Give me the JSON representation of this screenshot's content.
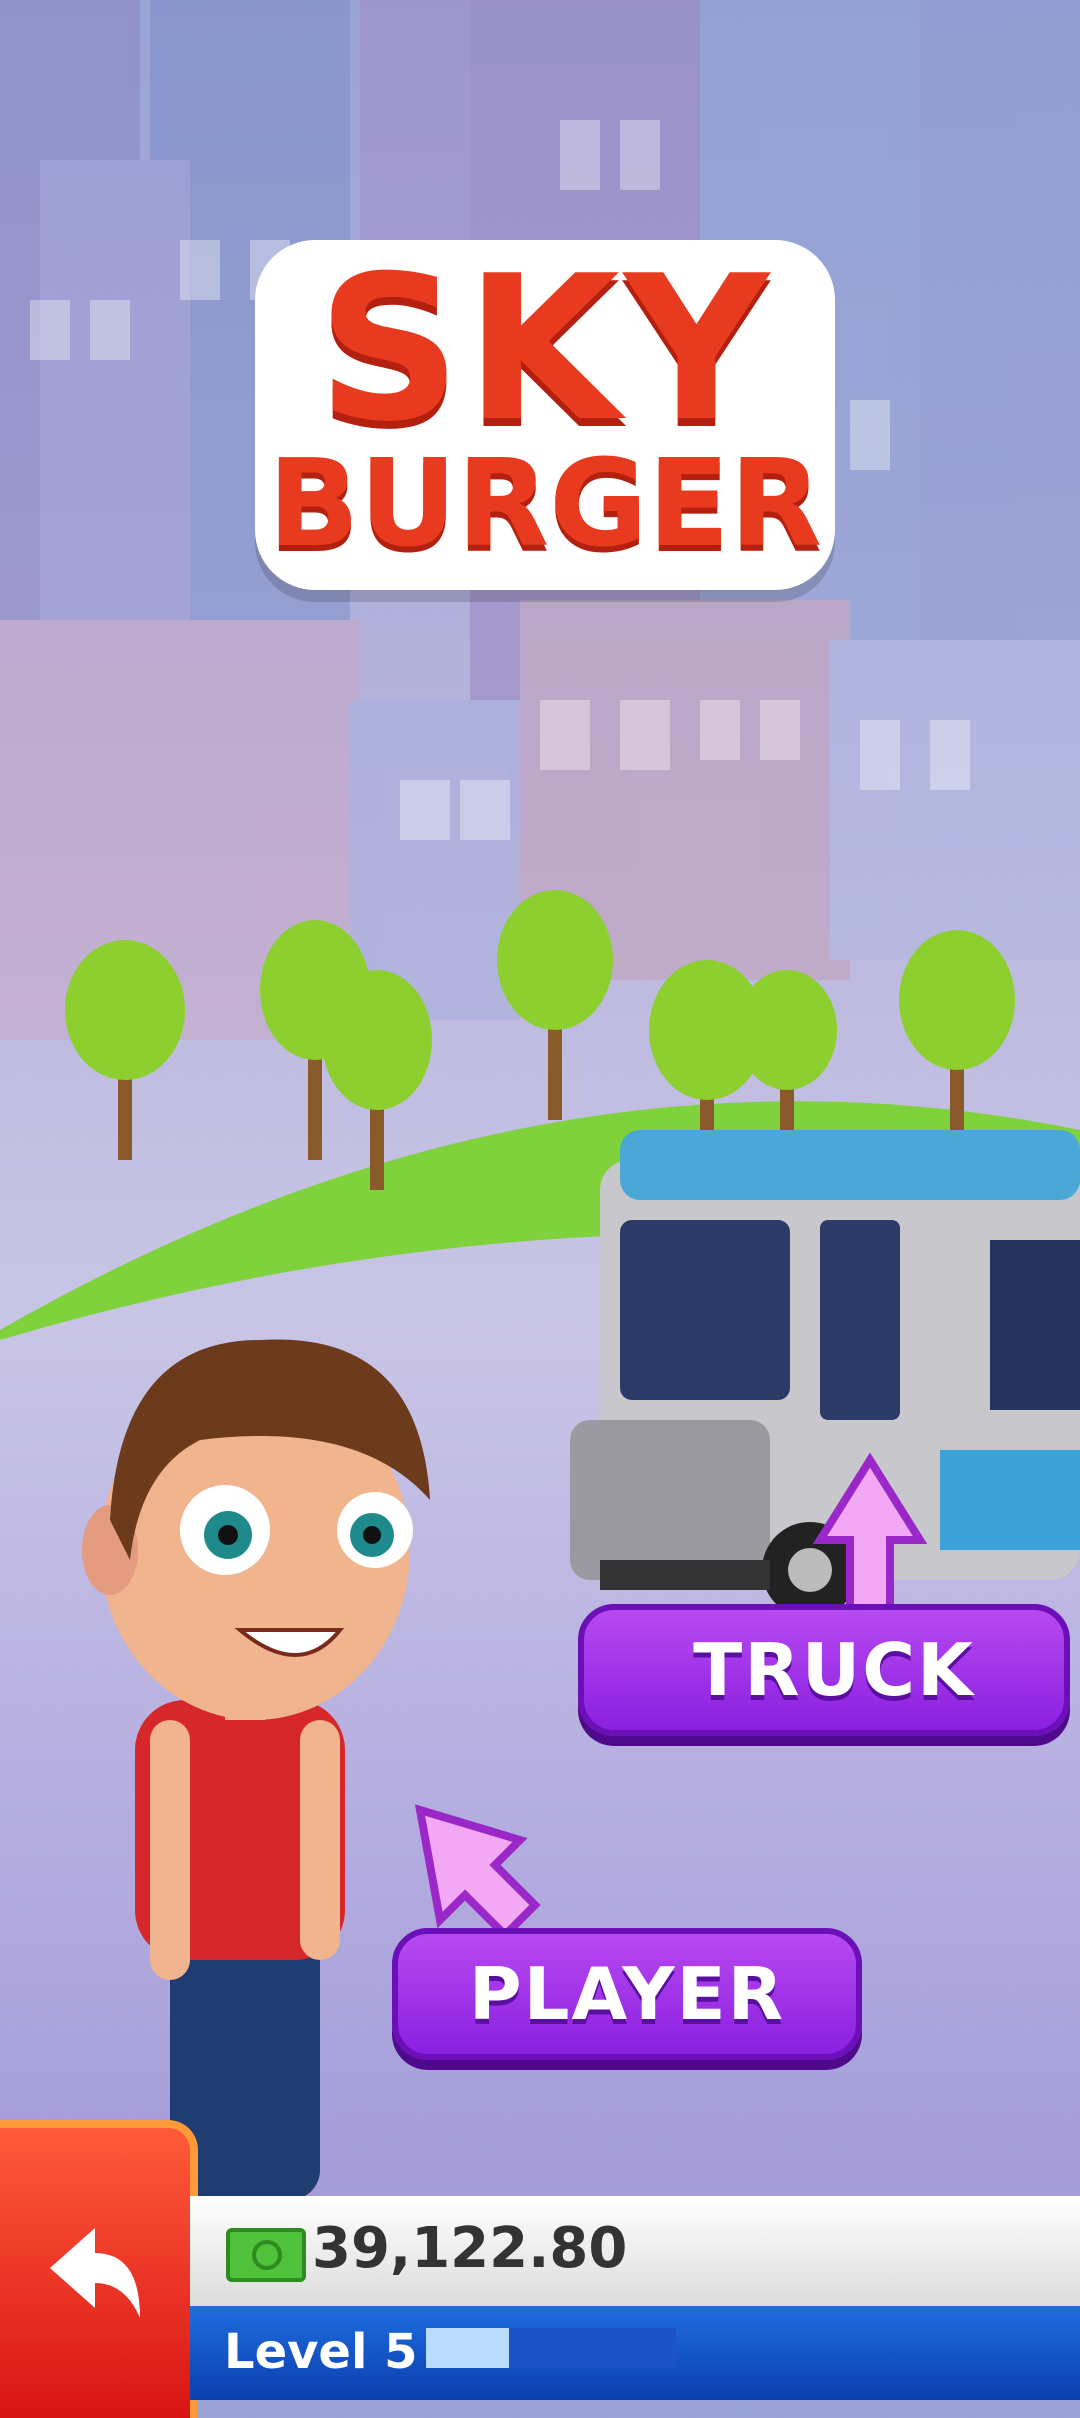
{
  "logo": {
    "line1": "SKY",
    "line2": "BURGER"
  },
  "buttons": {
    "truck": "TRUCK",
    "player": "PLAYER"
  },
  "money": {
    "value": "39,122.80"
  },
  "level": {
    "label": "Level 5",
    "progress": 0.33
  },
  "colors": {
    "button_purple": "#9b30e8",
    "logo_red": "#e83a1e",
    "back_red": "#e0231a",
    "level_blue": "#1557cc"
  }
}
